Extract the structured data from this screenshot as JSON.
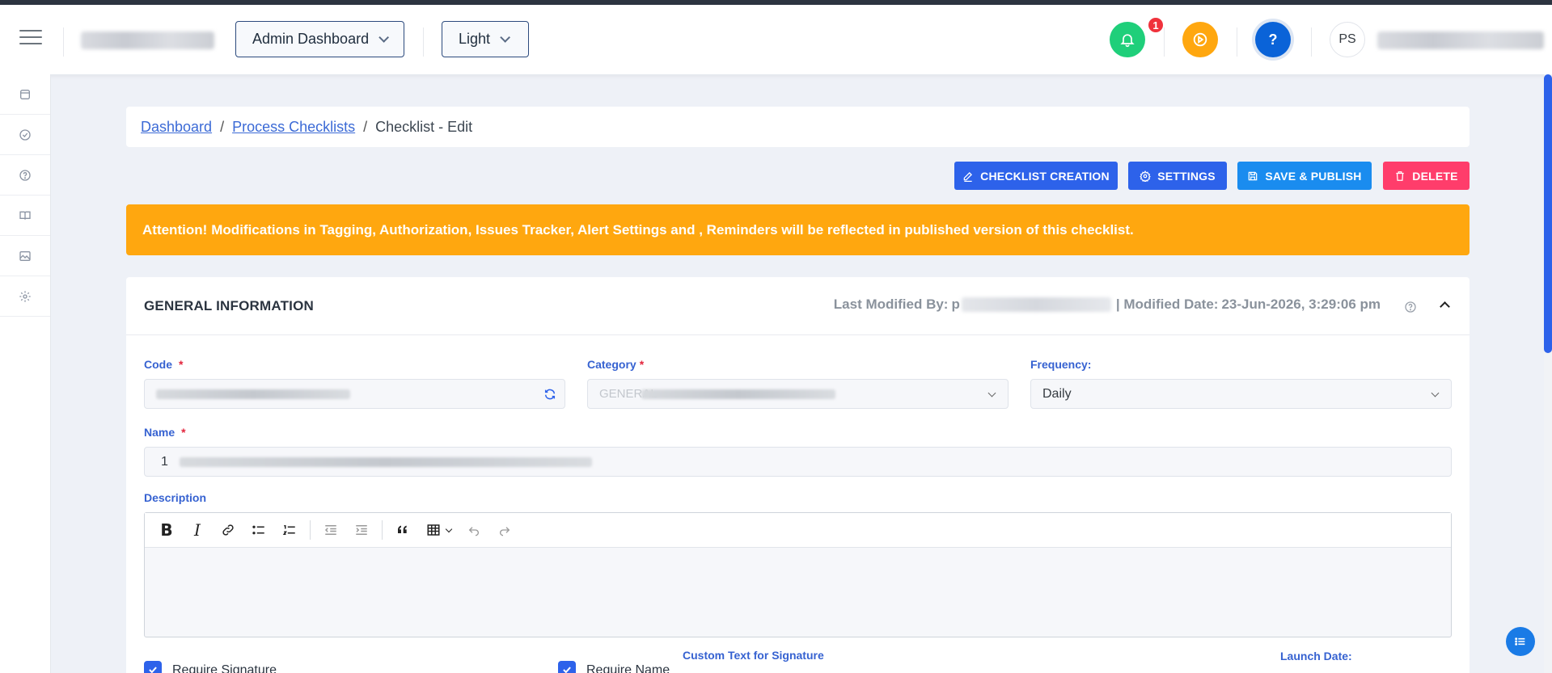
{
  "header": {
    "dashboard_select": "Admin Dashboard",
    "theme_select": "Light",
    "notification_count": "1",
    "user_initials": "PS"
  },
  "breadcrumb": {
    "items": [
      "Dashboard",
      "Process Checklists"
    ],
    "current": "Checklist - Edit"
  },
  "actions": {
    "checklist_creation": "CHECKLIST CREATION",
    "settings": "SETTINGS",
    "save_publish": "SAVE & PUBLISH",
    "delete": "DELETE"
  },
  "alert": {
    "lead": "Attention!",
    "message": "Modifications in Tagging, Authorization, Issues Tracker, Alert Settings and , Reminders will be reflected in published version of this checklist."
  },
  "general": {
    "title": "GENERAL INFORMATION",
    "last_modified_label": "Last Modified By:",
    "last_modified_prefix": "p",
    "modified_date_label": "| Modified Date:",
    "modified_date": "23-Jun-2026, 3:29:06 pm"
  },
  "form": {
    "code_label": "Code",
    "category_label": "Category",
    "category_prefix": "GENERAL",
    "frequency_label": "Frequency:",
    "frequency_value": "Daily",
    "name_label": "Name",
    "name_prefix": "1",
    "description_label": "Description",
    "require_signature": "Require Signature",
    "require_name": "Require Name",
    "custom_text_label": "Custom Text for Signature",
    "launch_date_label": "Launch Date:"
  },
  "colors": {
    "primary": "#2d62ea",
    "info": "#1a8cef",
    "danger": "#ff3d6b",
    "warning": "#ffa70f",
    "bell": "#1fcf7a",
    "play": "#ffa70f",
    "help": "#0a63d8"
  }
}
